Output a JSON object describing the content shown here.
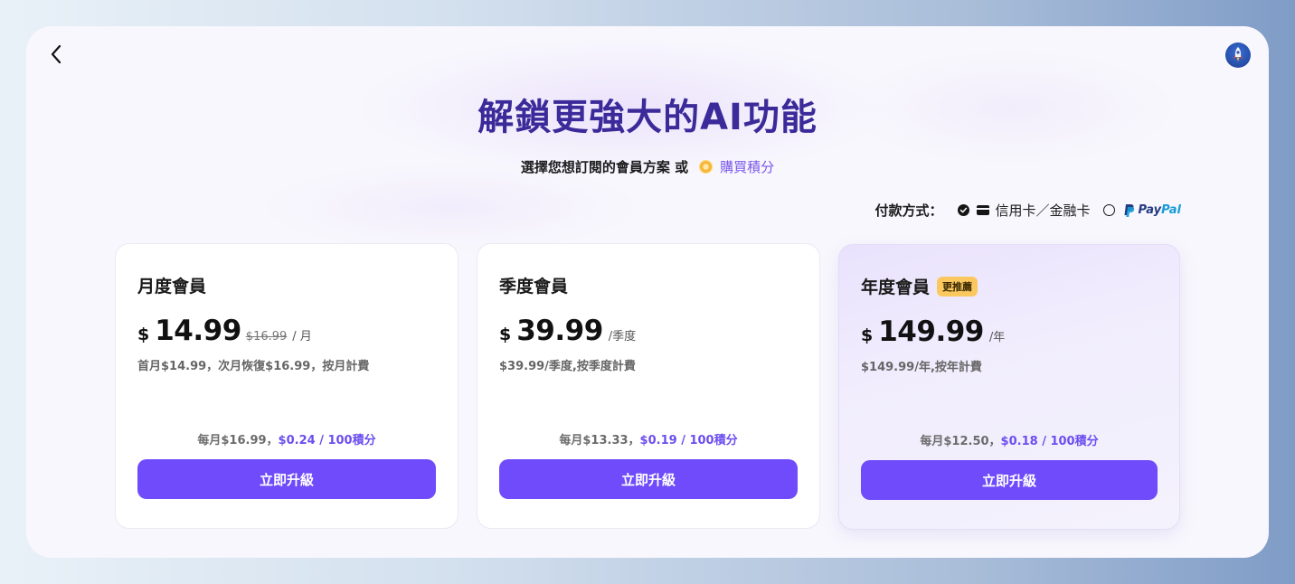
{
  "title": "解鎖更強大的AI功能",
  "subtitle": {
    "text": "選擇您想訂閱的會員方案 或",
    "buy_points": "購買積分"
  },
  "payment": {
    "label": "付款方式：",
    "options": [
      {
        "label": "信用卡／金融卡",
        "selected": true
      },
      {
        "label": "PayPal",
        "selected": false,
        "logo_parts": [
          "Pay",
          "Pal"
        ]
      }
    ]
  },
  "plans": [
    {
      "name": "月度會員",
      "badge": "",
      "currency": "$",
      "price": "14.99",
      "original_price": "$16.99",
      "unit": "/ 月",
      "description": "首月$14.99，次月恢復$16.99，按月計費",
      "monthly_prefix": "每月$16.99，",
      "monthly_rate": "$0.24 / 100積分",
      "button": "立即升級"
    },
    {
      "name": "季度會員",
      "badge": "",
      "currency": "$",
      "price": "39.99",
      "original_price": "",
      "unit": "/季度",
      "description": "$39.99/季度,按季度計費",
      "monthly_prefix": "每月$13.33，",
      "monthly_rate": "$0.19 / 100積分",
      "button": "立即升級"
    },
    {
      "name": "年度會員",
      "badge": "更推薦",
      "currency": "$",
      "price": "149.99",
      "original_price": "",
      "unit": "/年",
      "description": "$149.99/年,按年計費",
      "monthly_prefix": "每月$12.50，",
      "monthly_rate": "$0.18 / 100積分",
      "button": "立即升級"
    }
  ],
  "colors": {
    "accent": "#6f4bfb",
    "title": "#3b2a99",
    "badge": "#fbc860"
  },
  "icons": {
    "back": "chevron-left-icon",
    "avatar": "rocket-avatar",
    "coin": "coin-icon",
    "card": "credit-card-icon"
  }
}
